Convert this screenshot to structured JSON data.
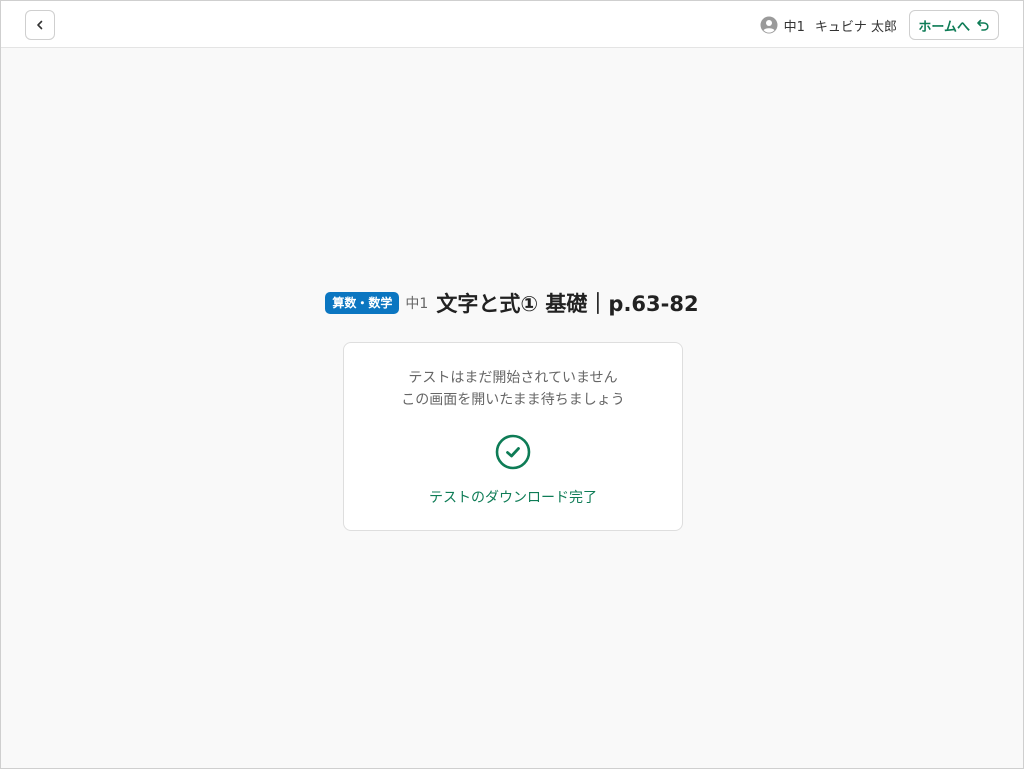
{
  "header": {
    "back_icon": "chevron-left-icon",
    "user": {
      "avatar_icon": "user-circle-icon",
      "grade": "中1",
      "name": "キュビナ 太郎"
    },
    "home_button": {
      "label": "ホームへ",
      "icon": "return-arrow-icon"
    }
  },
  "test": {
    "subject_badge": "算数・数学",
    "grade": "中1",
    "title": "文字と式① 基礎｜p.63-82"
  },
  "status_card": {
    "line1": "テストはまだ開始されていません",
    "line2": "この画面を開いたまま待ちましょう",
    "check_icon": "check-circle-icon",
    "download_status": "テストのダウンロード完了"
  },
  "colors": {
    "accent_green": "#0e7c56",
    "badge_blue": "#0b76c1",
    "background": "#f9f9f9"
  }
}
